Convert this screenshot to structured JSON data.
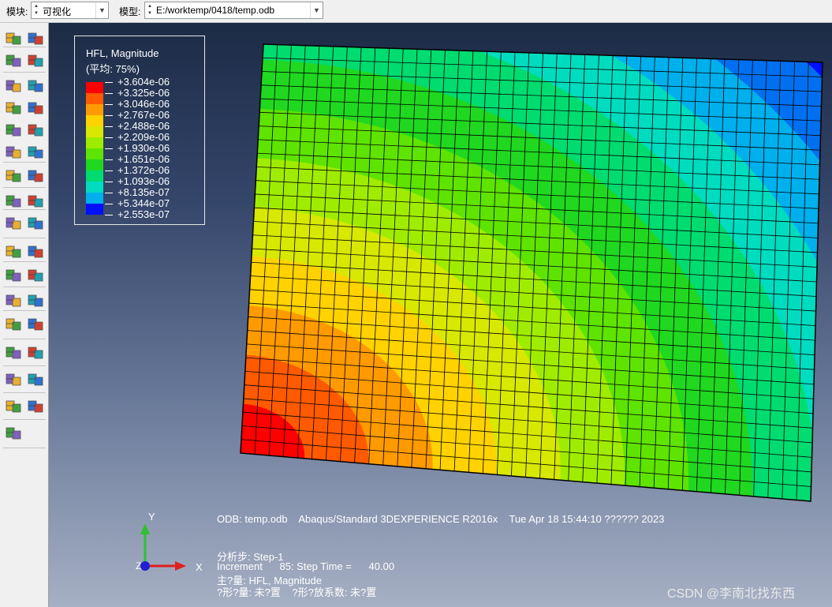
{
  "toolbar": {
    "module_label": "模块:",
    "module_value": "可视化",
    "model_label": "模型:",
    "model_value": "E:/worktemp/0418/temp.odb"
  },
  "toolbox": {
    "tools": [
      "query-icon",
      "render-model-icon",
      "deformed-shape-icon",
      "undeformed-shape-icon",
      "contour-plot-icon",
      "contour-options-icon",
      "symbol-plot-icon",
      "symbol-options-icon",
      "material-orientation-icon",
      "orientation-options-icon",
      "deform-scale-icon",
      "superimpose-icon",
      "animate-time-history-icon",
      "animate-options-icon",
      "animate-scale-icon",
      "create-field-output-icon",
      "coordinate-system-icon",
      "free-body-icon",
      "xy-data-icon",
      "xy-data-manager-icon",
      "path-icon",
      "xy-plot-icon",
      "view-cut-icon",
      "view-cut-manager-icon",
      "display-group-icon",
      "display-group-manager-icon",
      "element-set-icon",
      "set-manager-icon",
      "stream-icon",
      "stream-manager-icon",
      "transform-icon",
      "report-icon",
      "pencil-icon"
    ]
  },
  "legend": {
    "title": "HFL, Magnitude",
    "subtitle": "(平均: 75%)",
    "entries": [
      "+3.604e-06",
      "+3.325e-06",
      "+3.046e-06",
      "+2.767e-06",
      "+2.488e-06",
      "+2.209e-06",
      "+1.930e-06",
      "+1.651e-06",
      "+1.372e-06",
      "+1.093e-06",
      "+8.135e-07",
      "+5.344e-07",
      "+2.553e-07"
    ],
    "colors": [
      "#ff0000",
      "#ff5a00",
      "#ff9a00",
      "#ffd200",
      "#d8e800",
      "#a0ec00",
      "#5ee400",
      "#20d820",
      "#00dc70",
      "#00dcc0",
      "#00b0ec",
      "#0070f0",
      "#0010ff"
    ]
  },
  "contour": {
    "grid_cols": 40,
    "grid_rows": 30
  },
  "triad": {
    "x_label": "X",
    "y_label": "Y",
    "z_label": "Z"
  },
  "info": {
    "odb_line": "ODB: temp.odb    Abaqus/Standard 3DEXPERIENCE R2016x    Tue Apr 18 15:44:10 ?????? 2023",
    "step_line": "分析步: Step-1",
    "increment_line": "Increment      85: Step Time =      40.00",
    "primary_line": "主?量: HFL, Magnitude",
    "deform_line": "?形?量: 未?置    ?形?放系数: 未?置"
  },
  "watermark": "CSDN @李南北找东西"
}
